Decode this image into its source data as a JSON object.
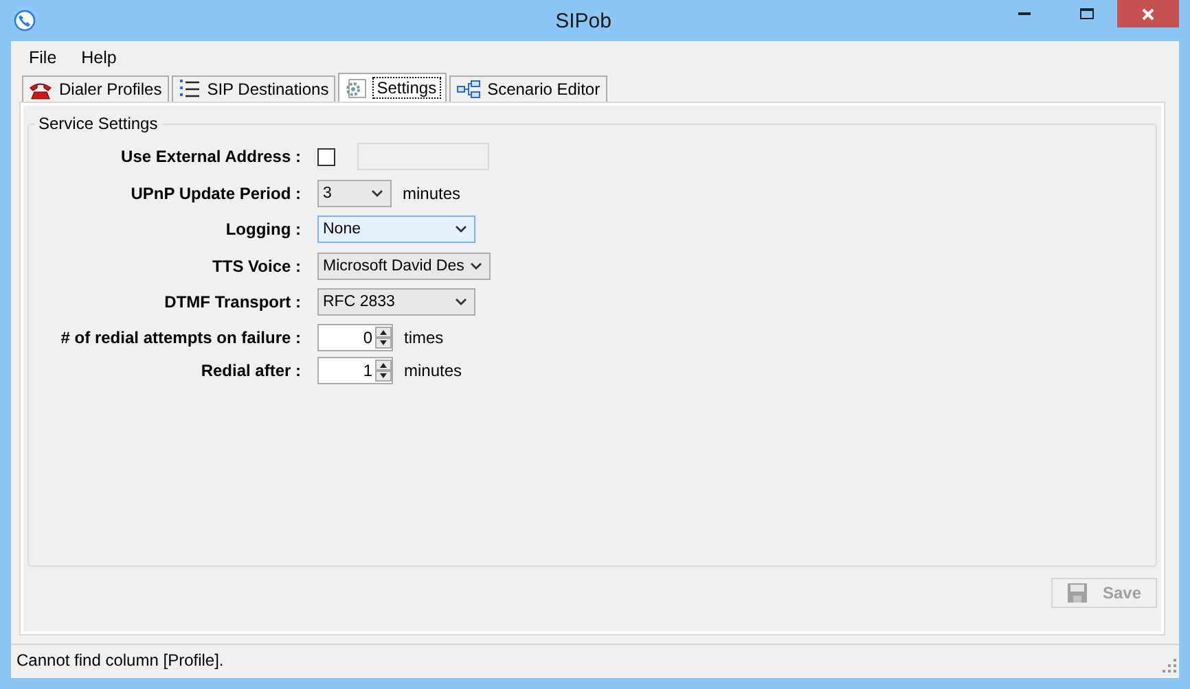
{
  "window": {
    "title": "SIPob"
  },
  "menu": [
    "File",
    "Help"
  ],
  "tabs": [
    {
      "label": "Dialer Profiles",
      "selected": false
    },
    {
      "label": "SIP Destinations",
      "selected": false
    },
    {
      "label": "Settings",
      "selected": true
    },
    {
      "label": "Scenario Editor",
      "selected": false
    }
  ],
  "group": {
    "title": "Service Settings",
    "rows": [
      {
        "label": "Use External Address :",
        "kind": "checkbox",
        "checked": false
      },
      {
        "label": "UPnP Update Period :",
        "kind": "combo",
        "value": "3",
        "unit": "minutes",
        "narrow": true,
        "focused": false
      },
      {
        "label": "Logging :",
        "kind": "combo",
        "value": "None",
        "focused": true
      },
      {
        "label": "TTS Voice :",
        "kind": "combo",
        "value": "Microsoft David Des",
        "focused": false
      },
      {
        "label": "DTMF Transport :",
        "kind": "combo",
        "value": "RFC 2833",
        "focused": false
      },
      {
        "label": "# of redial attempts on failure :",
        "kind": "spinner",
        "value": "0",
        "unit": "times"
      },
      {
        "label": "Redial after :",
        "kind": "spinner",
        "value": "1",
        "unit": "minutes"
      }
    ]
  },
  "save_button": {
    "label": "Save",
    "disabled": true
  },
  "status_bar": "Cannot find column [Profile]."
}
